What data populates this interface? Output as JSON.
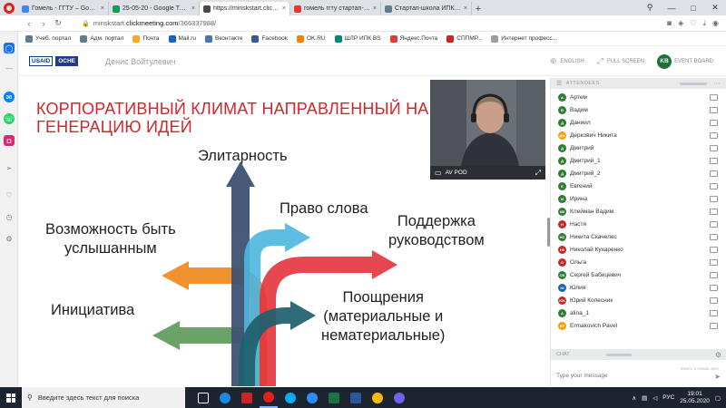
{
  "browser": {
    "tabs": [
      {
        "title": "Гомель - ГГТУ – Google Д...",
        "icon_color": "#4285f4"
      },
      {
        "title": "25-05-20 - Google Таблиц...",
        "icon_color": "#0f9d58"
      },
      {
        "title": "https://minskstart.clickme...",
        "icon_color": "#4a4a4a",
        "active": true
      },
      {
        "title": "гомель ггту стартап-школ...",
        "icon_color": "#e53935"
      },
      {
        "title": "Стартап-школа ИПК busi...",
        "icon_color": "#607d8b"
      }
    ],
    "new_tab": "+",
    "url_prefix": "minskstart.",
    "url_host": "clickmeeting.com",
    "url_path": "/366337988/",
    "bookmarks": [
      {
        "label": "Учеб. портал",
        "color": "#607d8b"
      },
      {
        "label": "Адм. портал",
        "color": "#607d8b"
      },
      {
        "label": "Почта",
        "color": "#f9a825"
      },
      {
        "label": "Mail.ru",
        "color": "#1565c0"
      },
      {
        "label": "Вконтакте",
        "color": "#4a76a8"
      },
      {
        "label": "Facebook",
        "color": "#3b5998"
      },
      {
        "label": "OK.RU",
        "color": "#ee8208"
      },
      {
        "label": "ШЛР ИПК BS",
        "color": "#00897b"
      },
      {
        "label": "Яндекс.Почта",
        "color": "#e53935"
      },
      {
        "label": "СППМР...",
        "color": "#c62828"
      },
      {
        "label": "Интернет професс...",
        "color": "#9e9e9e"
      }
    ]
  },
  "app": {
    "logo_usaid": "USAID",
    "logo_oson": "ОСНЕ",
    "presenter": "Денис Войтулевич",
    "english": "ENGLISH",
    "fullscreen": "FULL SCREEN",
    "event_board": "EVENT BOARD",
    "kb": "KB"
  },
  "slide": {
    "title": "КОРПОРАТИВНЫЙ КЛИМАТ НАПРАВЛЕННЫЙ НА ГЕНЕРАЦИЮ ИДЕЙ",
    "elite": "Элитарность",
    "voice": "Право слова",
    "support_1": "Поддержка",
    "support_2": "руководством",
    "heard_1": "Возможность быть",
    "heard_2": "услышанным",
    "reward_1": "Поощрения",
    "reward_2": "(материальные и",
    "reward_3": "нематериальные)",
    "initiative": "Инициатива",
    "arrow_colors": {
      "navy": "#3f5273",
      "blue": "#4db6e0",
      "red": "#e4343c",
      "orange": "#ef8a1e",
      "teal": "#1f5f6e",
      "green": "#5f9b5c"
    }
  },
  "video": {
    "label": "AV POD"
  },
  "attendees": {
    "header": "ATTENDEES",
    "list": [
      {
        "name": "Артем",
        "initials": "A",
        "color": "#2e7d32"
      },
      {
        "name": "Вадим",
        "initials": "B",
        "color": "#2e7d32"
      },
      {
        "name": "Даниил",
        "initials": "Д",
        "color": "#2e7d32"
      },
      {
        "name": "Деркович Никита",
        "initials": "ДН",
        "color": "#f4a100"
      },
      {
        "name": "Дмитрий",
        "initials": "Д",
        "color": "#2e7d32"
      },
      {
        "name": "Дмитрий_1",
        "initials": "Д",
        "color": "#2e7d32"
      },
      {
        "name": "Дмитрий_2",
        "initials": "Д",
        "color": "#2e7d32"
      },
      {
        "name": "Евгений",
        "initials": "Е",
        "color": "#2e7d32"
      },
      {
        "name": "Ирина",
        "initials": "И",
        "color": "#2e7d32"
      },
      {
        "name": "Клейман Вадим",
        "initials": "КВ",
        "color": "#2e7d32"
      },
      {
        "name": "Настя",
        "initials": "Н",
        "color": "#c62828"
      },
      {
        "name": "Никита Скачелес",
        "initials": "НС",
        "color": "#2e7d32"
      },
      {
        "name": "Николай Кухаренко",
        "initials": "НК",
        "color": "#c62828"
      },
      {
        "name": "Ольга",
        "initials": "О",
        "color": "#c62828"
      },
      {
        "name": "Сергей Бабицевич",
        "initials": "СБ",
        "color": "#2e7d32"
      },
      {
        "name": "Юлия",
        "initials": "Ю",
        "color": "#1565c0"
      },
      {
        "name": "Юрий Колесник",
        "initials": "ЮК",
        "color": "#c62828"
      },
      {
        "name": "alina_1",
        "initials": "A",
        "color": "#2e7d32"
      },
      {
        "name": "Ermakovich Pavel",
        "initials": "EP",
        "color": "#f4a100"
      }
    ]
  },
  "chat": {
    "header": "CHAT",
    "placeholder": "Type your message",
    "meta": "Жмать в новом окне"
  },
  "taskbar": {
    "search": "Введите здесь текст для поиска",
    "lang": "РУС",
    "time": "19:01",
    "date": "25.05.2020"
  }
}
